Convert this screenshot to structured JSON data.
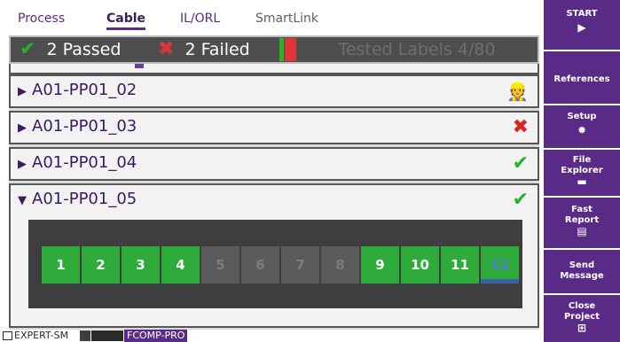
{
  "tabs": [
    {
      "label": "Process"
    },
    {
      "label": "Cable"
    },
    {
      "label": "IL/ORL"
    },
    {
      "label": "SmartLink"
    }
  ],
  "summary": {
    "passed": "2 Passed",
    "failed": "2 Failed",
    "tested": "Tested Labels 4/80"
  },
  "rows": [
    {
      "label": "A01-PP01_02",
      "status": "running",
      "status_icon": "👷"
    },
    {
      "label": "A01-PP01_03",
      "status": "failed",
      "status_icon": "✖"
    },
    {
      "label": "A01-PP01_04",
      "status": "passed",
      "status_icon": "✔"
    },
    {
      "label": "A01-PP01_05",
      "status": "passed",
      "status_icon": "✔"
    }
  ],
  "fibers": [
    {
      "n": "1",
      "state": "pass"
    },
    {
      "n": "2",
      "state": "pass"
    },
    {
      "n": "3",
      "state": "pass"
    },
    {
      "n": "4",
      "state": "pass"
    },
    {
      "n": "5",
      "state": "skip"
    },
    {
      "n": "6",
      "state": "skip"
    },
    {
      "n": "7",
      "state": "skip"
    },
    {
      "n": "8",
      "state": "skip"
    },
    {
      "n": "9",
      "state": "pass"
    },
    {
      "n": "10",
      "state": "pass"
    },
    {
      "n": "11",
      "state": "pass"
    },
    {
      "n": "12",
      "state": "pending"
    }
  ],
  "statusbar": {
    "module": "EXPERT-SM",
    "profile": "FCOMP-PRO"
  },
  "sidebar": {
    "start": "START",
    "references": "References",
    "setup": "Setup",
    "file_explorer_1": "File",
    "file_explorer_2": "Explorer",
    "fast_report_1": "Fast",
    "fast_report_2": "Report",
    "send_message_1": "Send",
    "send_message_2": "Message",
    "close_project_1": "Close",
    "close_project_2": "Project"
  },
  "colors": {
    "accent": "#5a2b86",
    "pass": "#28b429",
    "fail": "#d92424"
  }
}
